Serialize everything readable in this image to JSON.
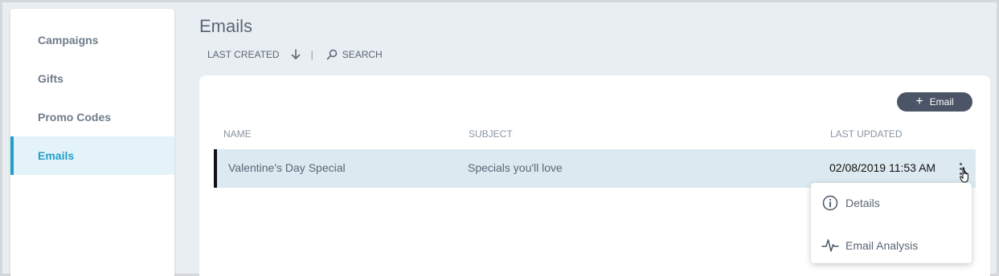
{
  "sidebar": {
    "items": [
      {
        "label": "Campaigns",
        "active": false
      },
      {
        "label": "Gifts",
        "active": false
      },
      {
        "label": "Promo Codes",
        "active": false
      },
      {
        "label": "Emails",
        "active": true
      }
    ],
    "accent_color": "#1fa0c9"
  },
  "header": {
    "title": "Emails",
    "sort_label": "LAST CREATED",
    "sort_icon": "arrow-down-icon",
    "separator": "|",
    "search_label": "SEARCH",
    "search_icon": "search-icon"
  },
  "card": {
    "add_button_label": "Email",
    "add_button_icon": "plus-icon",
    "columns": [
      "NAME",
      "SUBJECT",
      "LAST UPDATED"
    ],
    "rows": [
      {
        "name": "Valentine's Day Special",
        "subject": "Specials you'll love",
        "last_updated": "02/08/2019 11:53 AM",
        "selected": true
      }
    ],
    "row_menu_icon": "more-vertical-icon"
  },
  "row_menu": {
    "items": [
      {
        "label": "Details",
        "icon": "info-icon"
      },
      {
        "label": "Email Analysis",
        "icon": "pulse-icon"
      }
    ]
  },
  "colors": {
    "background": "#e9eef2",
    "selected_row": "#dde9f1",
    "button": "#4b5567"
  }
}
